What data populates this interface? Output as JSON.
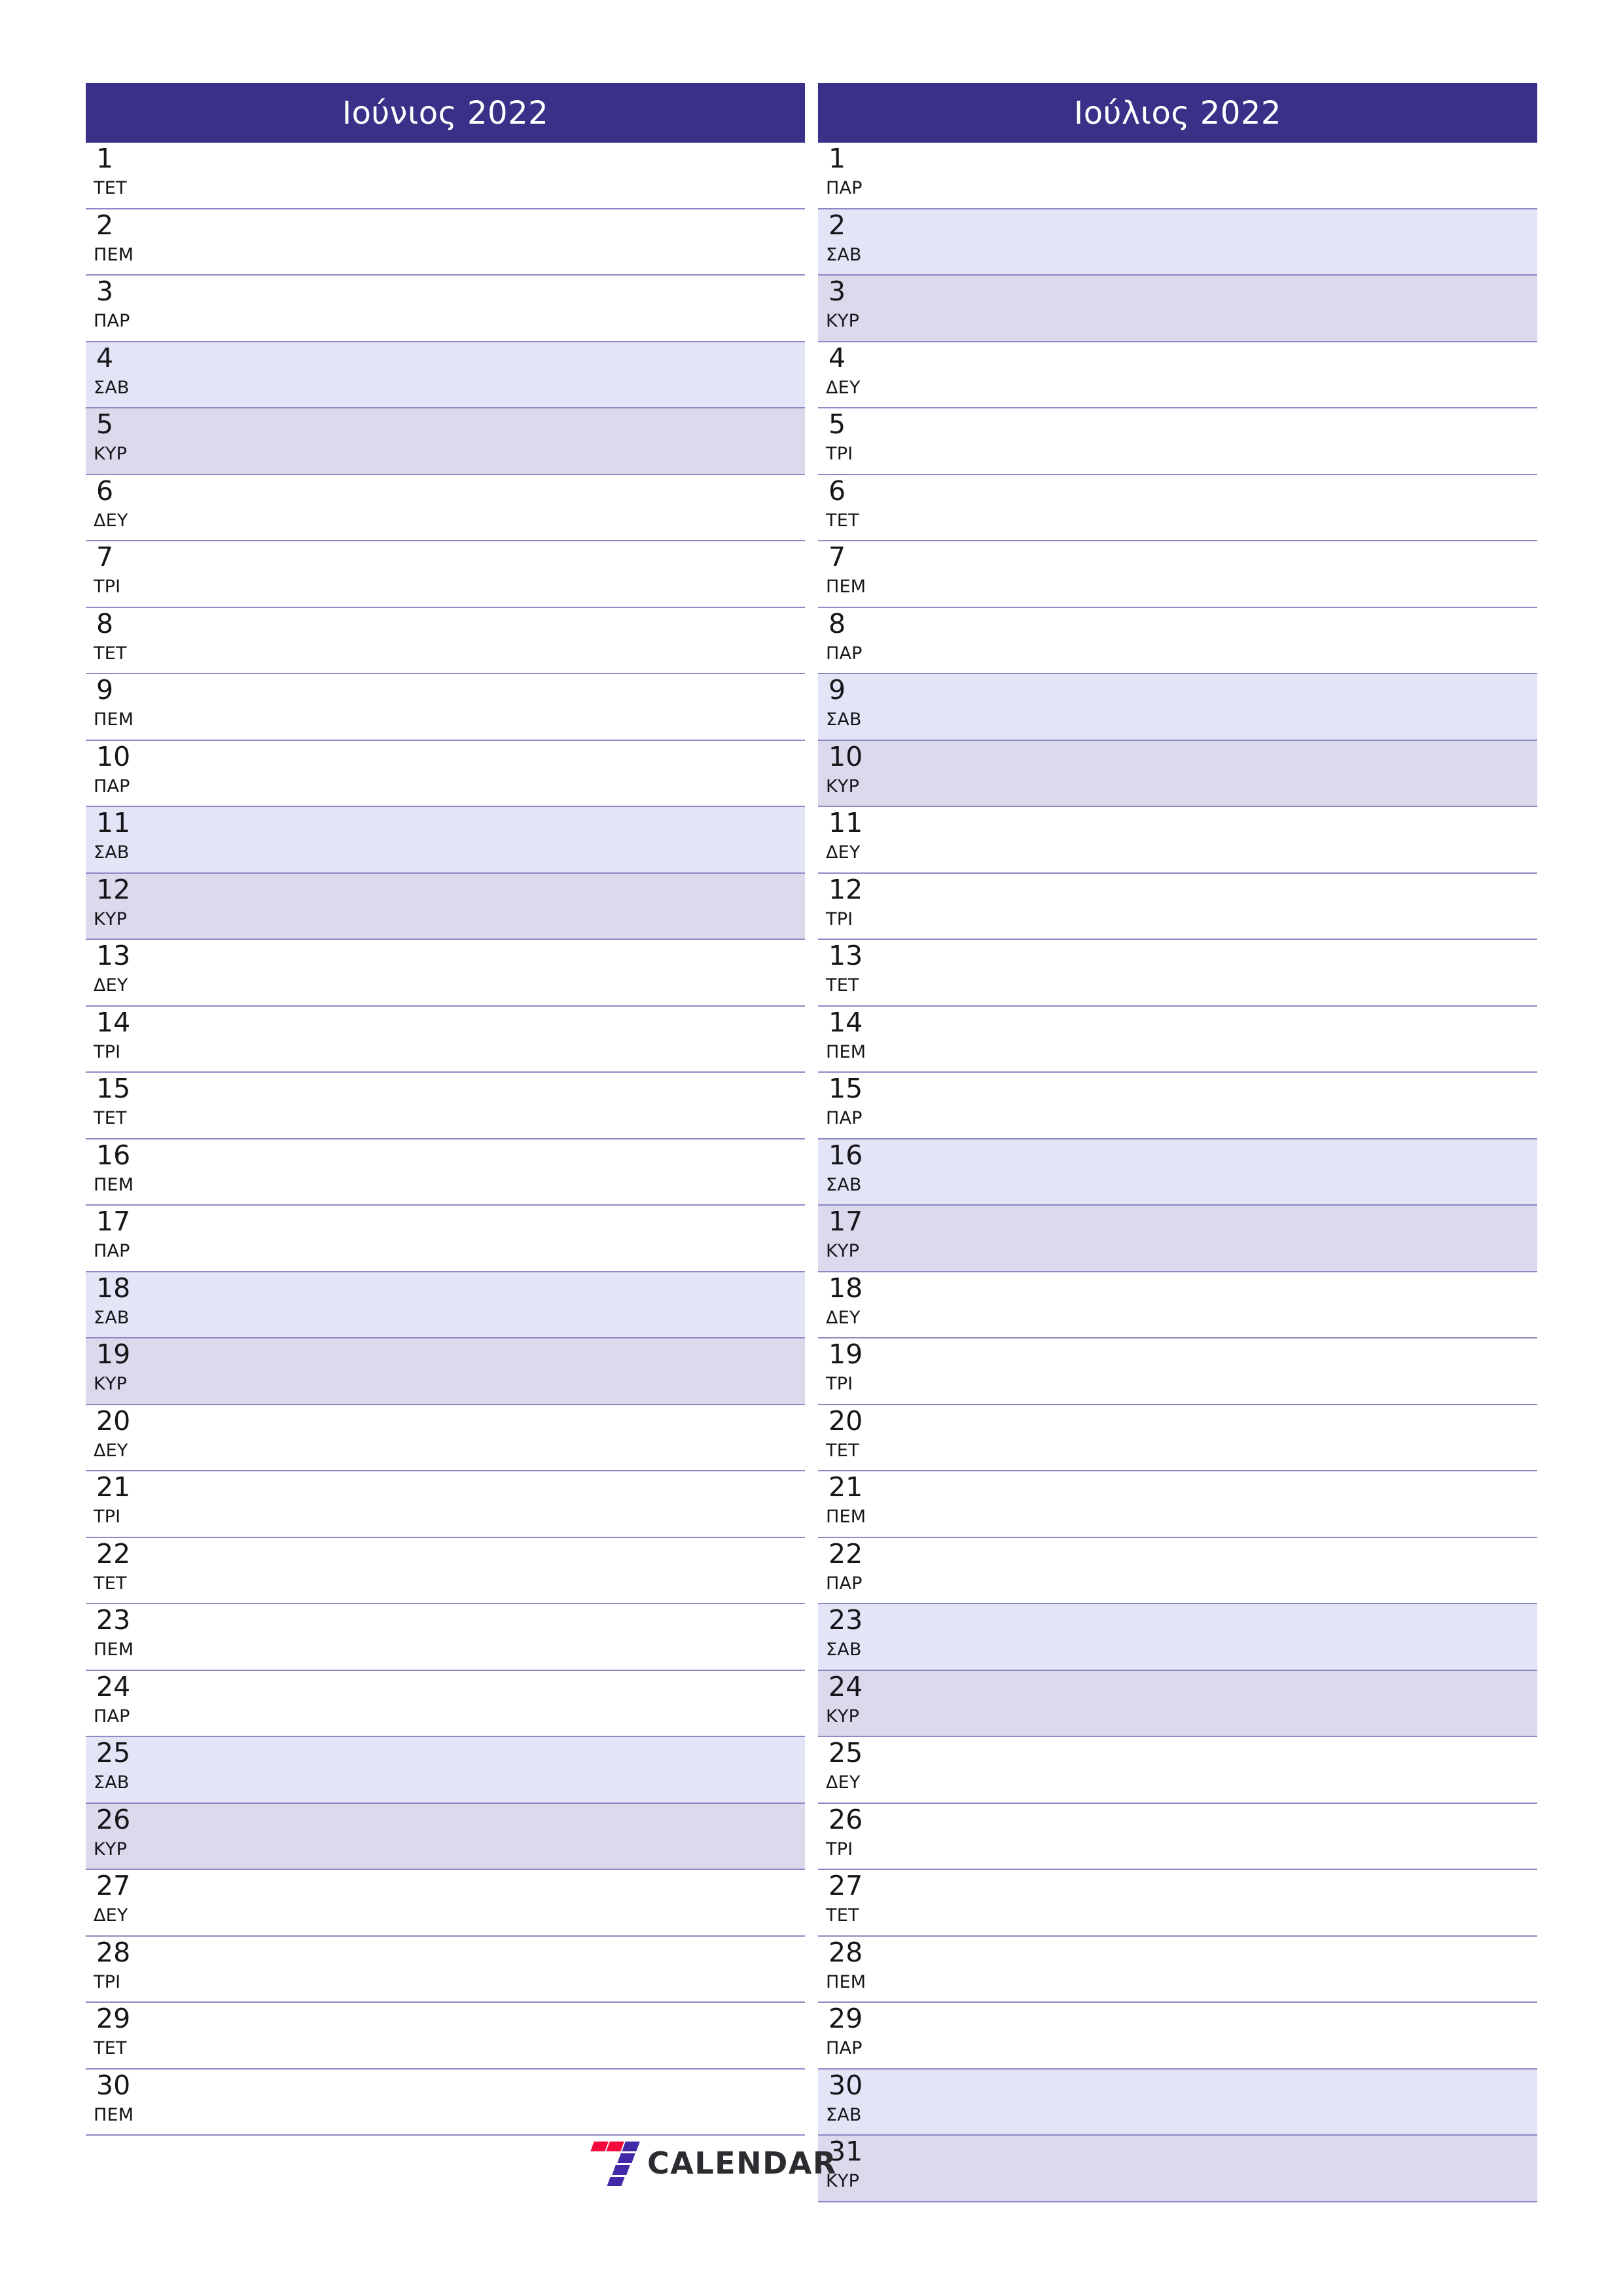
{
  "theme": {
    "header_bg": "#393088",
    "header_text": "#ffffff",
    "saturday_bg": "#e3e4f6",
    "sunday_bg": "#dcd9ec",
    "row_divider": "#8d88c6",
    "day_text": "#16161a",
    "logo_red": "#f5083c",
    "logo_blue": "#4229a8",
    "logo_text_color": "#2b2b30"
  },
  "months": [
    {
      "title": "Ιούνιος 2022",
      "days": [
        {
          "num": "1",
          "weekday": "ΤΕΤ",
          "type": "weekday"
        },
        {
          "num": "2",
          "weekday": "ΠΕΜ",
          "type": "weekday"
        },
        {
          "num": "3",
          "weekday": "ΠΑΡ",
          "type": "weekday"
        },
        {
          "num": "4",
          "weekday": "ΣΑΒ",
          "type": "sat"
        },
        {
          "num": "5",
          "weekday": "ΚΥΡ",
          "type": "sun"
        },
        {
          "num": "6",
          "weekday": "ΔΕΥ",
          "type": "weekday"
        },
        {
          "num": "7",
          "weekday": "ΤΡΙ",
          "type": "weekday"
        },
        {
          "num": "8",
          "weekday": "ΤΕΤ",
          "type": "weekday"
        },
        {
          "num": "9",
          "weekday": "ΠΕΜ",
          "type": "weekday"
        },
        {
          "num": "10",
          "weekday": "ΠΑΡ",
          "type": "weekday"
        },
        {
          "num": "11",
          "weekday": "ΣΑΒ",
          "type": "sat"
        },
        {
          "num": "12",
          "weekday": "ΚΥΡ",
          "type": "sun"
        },
        {
          "num": "13",
          "weekday": "ΔΕΥ",
          "type": "weekday"
        },
        {
          "num": "14",
          "weekday": "ΤΡΙ",
          "type": "weekday"
        },
        {
          "num": "15",
          "weekday": "ΤΕΤ",
          "type": "weekday"
        },
        {
          "num": "16",
          "weekday": "ΠΕΜ",
          "type": "weekday"
        },
        {
          "num": "17",
          "weekday": "ΠΑΡ",
          "type": "weekday"
        },
        {
          "num": "18",
          "weekday": "ΣΑΒ",
          "type": "sat"
        },
        {
          "num": "19",
          "weekday": "ΚΥΡ",
          "type": "sun"
        },
        {
          "num": "20",
          "weekday": "ΔΕΥ",
          "type": "weekday"
        },
        {
          "num": "21",
          "weekday": "ΤΡΙ",
          "type": "weekday"
        },
        {
          "num": "22",
          "weekday": "ΤΕΤ",
          "type": "weekday"
        },
        {
          "num": "23",
          "weekday": "ΠΕΜ",
          "type": "weekday"
        },
        {
          "num": "24",
          "weekday": "ΠΑΡ",
          "type": "weekday"
        },
        {
          "num": "25",
          "weekday": "ΣΑΒ",
          "type": "sat"
        },
        {
          "num": "26",
          "weekday": "ΚΥΡ",
          "type": "sun"
        },
        {
          "num": "27",
          "weekday": "ΔΕΥ",
          "type": "weekday"
        },
        {
          "num": "28",
          "weekday": "ΤΡΙ",
          "type": "weekday"
        },
        {
          "num": "29",
          "weekday": "ΤΕΤ",
          "type": "weekday"
        },
        {
          "num": "30",
          "weekday": "ΠΕΜ",
          "type": "weekday"
        }
      ]
    },
    {
      "title": "Ιούλιος 2022",
      "days": [
        {
          "num": "1",
          "weekday": "ΠΑΡ",
          "type": "weekday"
        },
        {
          "num": "2",
          "weekday": "ΣΑΒ",
          "type": "sat"
        },
        {
          "num": "3",
          "weekday": "ΚΥΡ",
          "type": "sun"
        },
        {
          "num": "4",
          "weekday": "ΔΕΥ",
          "type": "weekday"
        },
        {
          "num": "5",
          "weekday": "ΤΡΙ",
          "type": "weekday"
        },
        {
          "num": "6",
          "weekday": "ΤΕΤ",
          "type": "weekday"
        },
        {
          "num": "7",
          "weekday": "ΠΕΜ",
          "type": "weekday"
        },
        {
          "num": "8",
          "weekday": "ΠΑΡ",
          "type": "weekday"
        },
        {
          "num": "9",
          "weekday": "ΣΑΒ",
          "type": "sat"
        },
        {
          "num": "10",
          "weekday": "ΚΥΡ",
          "type": "sun"
        },
        {
          "num": "11",
          "weekday": "ΔΕΥ",
          "type": "weekday"
        },
        {
          "num": "12",
          "weekday": "ΤΡΙ",
          "type": "weekday"
        },
        {
          "num": "13",
          "weekday": "ΤΕΤ",
          "type": "weekday"
        },
        {
          "num": "14",
          "weekday": "ΠΕΜ",
          "type": "weekday"
        },
        {
          "num": "15",
          "weekday": "ΠΑΡ",
          "type": "weekday"
        },
        {
          "num": "16",
          "weekday": "ΣΑΒ",
          "type": "sat"
        },
        {
          "num": "17",
          "weekday": "ΚΥΡ",
          "type": "sun"
        },
        {
          "num": "18",
          "weekday": "ΔΕΥ",
          "type": "weekday"
        },
        {
          "num": "19",
          "weekday": "ΤΡΙ",
          "type": "weekday"
        },
        {
          "num": "20",
          "weekday": "ΤΕΤ",
          "type": "weekday"
        },
        {
          "num": "21",
          "weekday": "ΠΕΜ",
          "type": "weekday"
        },
        {
          "num": "22",
          "weekday": "ΠΑΡ",
          "type": "weekday"
        },
        {
          "num": "23",
          "weekday": "ΣΑΒ",
          "type": "sat"
        },
        {
          "num": "24",
          "weekday": "ΚΥΡ",
          "type": "sun"
        },
        {
          "num": "25",
          "weekday": "ΔΕΥ",
          "type": "weekday"
        },
        {
          "num": "26",
          "weekday": "ΤΡΙ",
          "type": "weekday"
        },
        {
          "num": "27",
          "weekday": "ΤΕΤ",
          "type": "weekday"
        },
        {
          "num": "28",
          "weekday": "ΠΕΜ",
          "type": "weekday"
        },
        {
          "num": "29",
          "weekday": "ΠΑΡ",
          "type": "weekday"
        },
        {
          "num": "30",
          "weekday": "ΣΑΒ",
          "type": "sat"
        },
        {
          "num": "31",
          "weekday": "ΚΥΡ",
          "type": "sun"
        }
      ]
    }
  ],
  "footer": {
    "logo_text": "CALENDAR",
    "logo_mark_name": "seven-logo-icon"
  }
}
